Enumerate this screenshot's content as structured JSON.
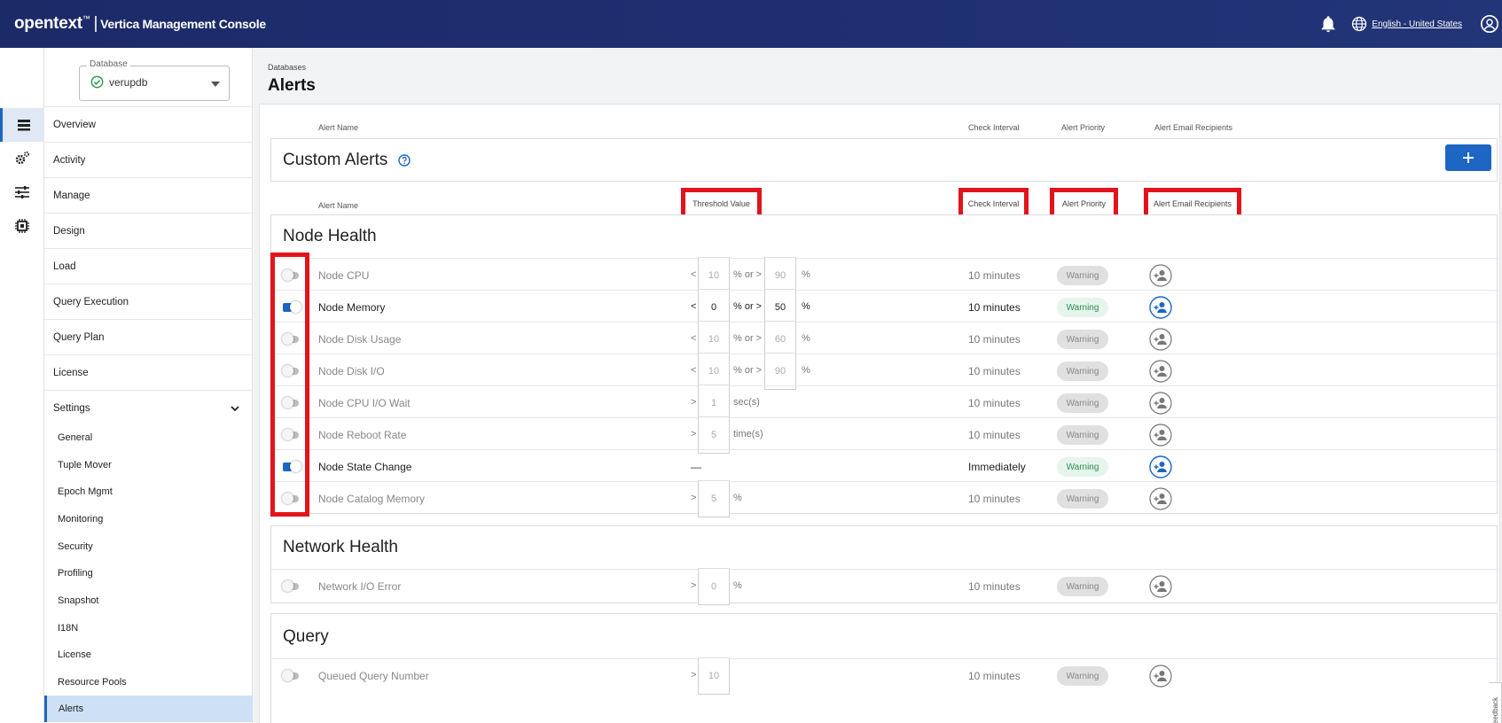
{
  "header": {
    "brand": "opentext",
    "trademark": "™",
    "separator": "|",
    "product": "Vertica Management Console",
    "language": "English - United States"
  },
  "rail": {
    "icons": [
      "list-icon",
      "gear-cluster-icon",
      "sliders-icon",
      "chip-icon"
    ]
  },
  "database": {
    "legend": "Database",
    "value": "verupdb",
    "status_color": "#2e9b4f"
  },
  "nav": {
    "items": [
      "Overview",
      "Activity",
      "Manage",
      "Design",
      "Load",
      "Query Execution",
      "Query Plan",
      "License",
      "Settings"
    ],
    "sub_items": [
      "General",
      "Tuple Mover",
      "Epoch Mgmt",
      "Monitoring",
      "Security",
      "Profiling",
      "Snapshot",
      "I18N",
      "License",
      "Resource Pools",
      "Alerts"
    ],
    "active_sub": "Alerts"
  },
  "page": {
    "breadcrumb": "Databases",
    "title": "Alerts"
  },
  "table_headers": {
    "alert_name": "Alert Name",
    "threshold_value": "Threshold Value",
    "check_interval": "Check Interval",
    "alert_priority": "Alert Priority",
    "email_recipients": "Alert Email Recipients"
  },
  "custom_alerts": {
    "title": "Custom Alerts",
    "add_label": "+"
  },
  "node_health": {
    "title": "Node Health",
    "rows": [
      {
        "name": "Node CPU",
        "enabled": false,
        "op": "<",
        "v1": "10",
        "mid": "% or >",
        "v2": "90",
        "unit": "%",
        "interval": "10 minutes",
        "priority": "Warning"
      },
      {
        "name": "Node Memory",
        "enabled": true,
        "op": "<",
        "v1": "0",
        "mid": "% or >",
        "v2": "50",
        "unit": "%",
        "interval": "10 minutes",
        "priority": "Warning"
      },
      {
        "name": "Node Disk Usage",
        "enabled": false,
        "op": "<",
        "v1": "10",
        "mid": "% or >",
        "v2": "60",
        "unit": "%",
        "interval": "10 minutes",
        "priority": "Warning"
      },
      {
        "name": "Node Disk I/O",
        "enabled": false,
        "op": "<",
        "v1": "10",
        "mid": "% or >",
        "v2": "90",
        "unit": "%",
        "interval": "10 minutes",
        "priority": "Warning"
      },
      {
        "name": "Node CPU I/O Wait",
        "enabled": false,
        "op": ">",
        "v1": "1",
        "unit": "sec(s)",
        "interval": "10 minutes",
        "priority": "Warning"
      },
      {
        "name": "Node Reboot Rate",
        "enabled": false,
        "op": ">",
        "v1": "5",
        "unit": "time(s)",
        "interval": "10 minutes",
        "priority": "Warning"
      },
      {
        "name": "Node State Change",
        "enabled": true,
        "op": "—",
        "interval": "Immediately",
        "priority": "Warning"
      },
      {
        "name": "Node Catalog Memory",
        "enabled": false,
        "op": ">",
        "v1": "5",
        "unit": "%",
        "interval": "10 minutes",
        "priority": "Warning"
      }
    ]
  },
  "network_health": {
    "title": "Network Health",
    "rows": [
      {
        "name": "Network I/O Error",
        "enabled": false,
        "op": ">",
        "v1": "0",
        "unit": "%",
        "interval": "10 minutes",
        "priority": "Warning"
      }
    ]
  },
  "query": {
    "title": "Query",
    "rows": [
      {
        "name": "Queued Query Number",
        "enabled": false,
        "op": ">",
        "v1": "10",
        "interval": "10 minutes",
        "priority": "Warning"
      }
    ]
  },
  "feedback_label": "Feedback",
  "colors": {
    "header_bg": "#1f2f72",
    "accent": "#1d66c3",
    "highlight_red": "#e3131c"
  }
}
